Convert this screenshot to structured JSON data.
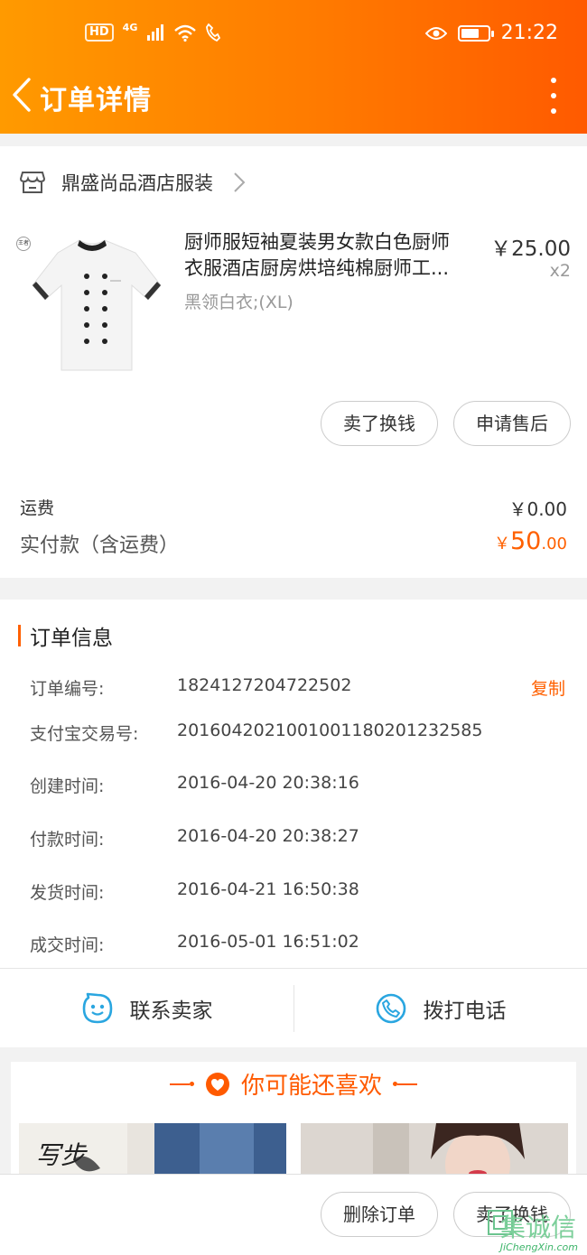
{
  "status_bar": {
    "hd": "HD",
    "network": "4G",
    "time": "21:22",
    "battery_level_pct": 70
  },
  "nav": {
    "title": "订单详情"
  },
  "shop": {
    "name": "鼎盛尚品酒店服装"
  },
  "product": {
    "brand_tag": "王者",
    "title_line1": "厨师服短袖夏装男女款白色厨师",
    "title_line2": "衣服酒店厨房烘培纯棉厨师工...",
    "sku": "黑领白衣;(XL)",
    "price": "￥25.00",
    "quantity": "x2",
    "buttons": [
      "卖了换钱",
      "申请售后"
    ]
  },
  "payment": {
    "shipping_label": "运费",
    "shipping_value": "￥0.00",
    "total_label": "实付款（含运费）",
    "total_currency": "￥",
    "total_int": "50",
    "total_dec": ".00"
  },
  "order_info": {
    "section_title": "订单信息",
    "copy_label": "复制",
    "rows": [
      {
        "label": "订单编号:",
        "value": "1824127204722502"
      },
      {
        "label": "支付宝交易号:",
        "value": "2016042021001001180201232585"
      },
      {
        "label": "创建时间:",
        "value": "2016-04-20 20:38:16"
      },
      {
        "label": "付款时间:",
        "value": "2016-04-20 20:38:27"
      },
      {
        "label": "发货时间:",
        "value": "2016-04-21 16:50:38"
      },
      {
        "label": "成交时间:",
        "value": "2016-05-01 16:51:02"
      }
    ]
  },
  "contact": {
    "seller": "联系卖家",
    "phone": "拨打电话"
  },
  "recommend": {
    "title": "你可能还喜欢",
    "image_left_text": "写步"
  },
  "bottom_bar": {
    "buttons": [
      "删除订单",
      "卖了换钱"
    ]
  },
  "watermark": {
    "title": "集诚信",
    "subtitle": "JiChengXin.com"
  },
  "colors": {
    "accent": "#ff6000",
    "header_start": "#ff9a00",
    "header_end": "#ff5a00",
    "icon_blue": "#2aa6e0"
  }
}
